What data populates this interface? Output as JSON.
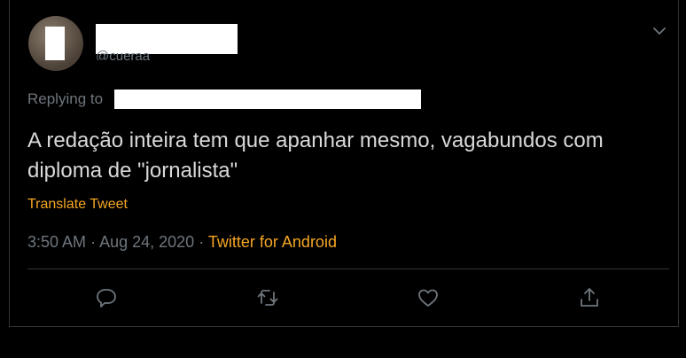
{
  "tweet": {
    "handle": "@cueraa",
    "replying_to": "Replying to",
    "text": "A redação inteira tem que apanhar mesmo, vagabundos com diploma de \"jornalista\"",
    "translate_label": "Translate Tweet",
    "time": "3:50 AM",
    "date": "Aug 24, 2020",
    "separator": "·",
    "source": "Twitter for Android"
  },
  "icons": {
    "more": "chevron-down-icon",
    "reply": "reply-icon",
    "retweet": "retweet-icon",
    "like": "heart-icon",
    "share": "share-icon"
  },
  "colors": {
    "background": "#000000",
    "text": "#d9d9d9",
    "muted": "#6e767d",
    "accent": "#f5a623"
  }
}
